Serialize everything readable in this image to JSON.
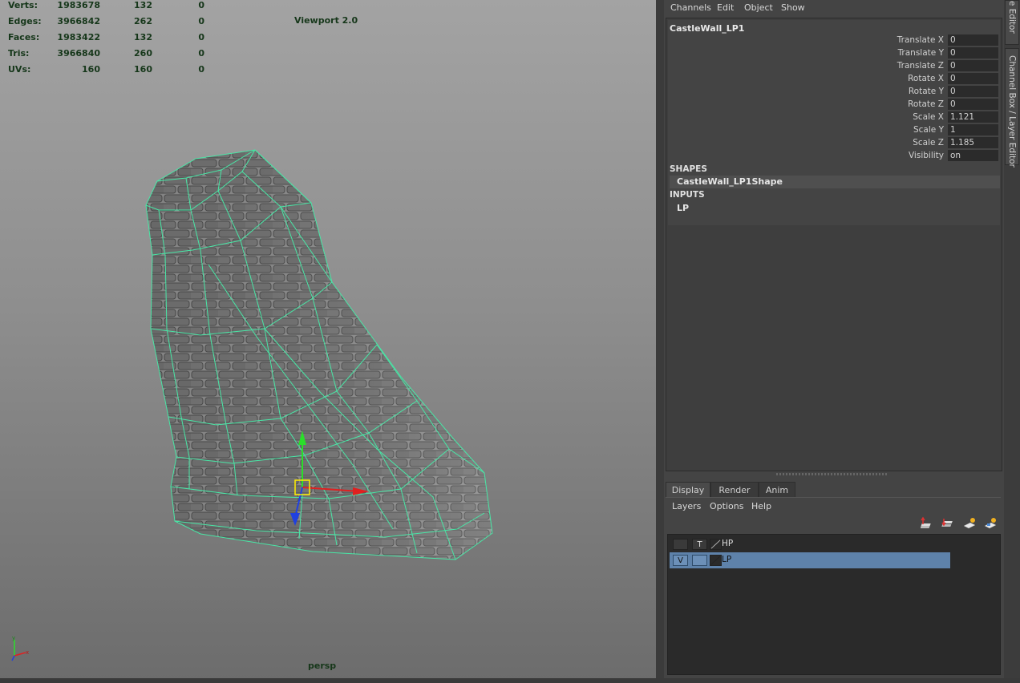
{
  "hud": {
    "rows": [
      {
        "label": "Verts:",
        "v1": "1983678",
        "v2": "132",
        "v3": "0"
      },
      {
        "label": "Edges:",
        "v1": "3966842",
        "v2": "262",
        "v3": "0"
      },
      {
        "label": "Faces:",
        "v1": "1983422",
        "v2": "132",
        "v3": "0"
      },
      {
        "label": "Tris:",
        "v1": "3966840",
        "v2": "260",
        "v3": "0"
      },
      {
        "label": "UVs:",
        "v1": "160",
        "v2": "160",
        "v3": "0"
      }
    ],
    "renderer": "Viewport 2.0",
    "camera": "persp"
  },
  "channel_box": {
    "menu": [
      "Channels",
      "Edit",
      "Object",
      "Show"
    ],
    "object_name": "CastleWall_LP1",
    "attributes": [
      {
        "label": "Translate X",
        "value": "0"
      },
      {
        "label": "Translate Y",
        "value": "0"
      },
      {
        "label": "Translate Z",
        "value": "0"
      },
      {
        "label": "Rotate X",
        "value": "0"
      },
      {
        "label": "Rotate Y",
        "value": "0"
      },
      {
        "label": "Rotate Z",
        "value": "0"
      },
      {
        "label": "Scale X",
        "value": "1.121"
      },
      {
        "label": "Scale Y",
        "value": "1"
      },
      {
        "label": "Scale Z",
        "value": "1.185"
      },
      {
        "label": "Visibility",
        "value": "on"
      }
    ],
    "shapes_header": "SHAPES",
    "shape_name": "CastleWall_LP1Shape",
    "inputs_header": "INPUTS",
    "input_name": "LP"
  },
  "layer_editor": {
    "tabs": [
      "Display",
      "Render",
      "Anim"
    ],
    "active_tab": "Display",
    "menu": [
      "Layers",
      "Options",
      "Help"
    ],
    "layers": [
      {
        "vis": "",
        "type": "T",
        "name": "HP",
        "selected": false
      },
      {
        "vis": "V",
        "type": "",
        "name": "LP",
        "selected": true
      }
    ]
  },
  "side_tabs": [
    "Attribute Editor",
    "Channel Box / Layer Editor"
  ],
  "colors": {
    "wireframe": "#49e6a6",
    "hud_text": "#16371a",
    "selection": "#5e82aa"
  }
}
